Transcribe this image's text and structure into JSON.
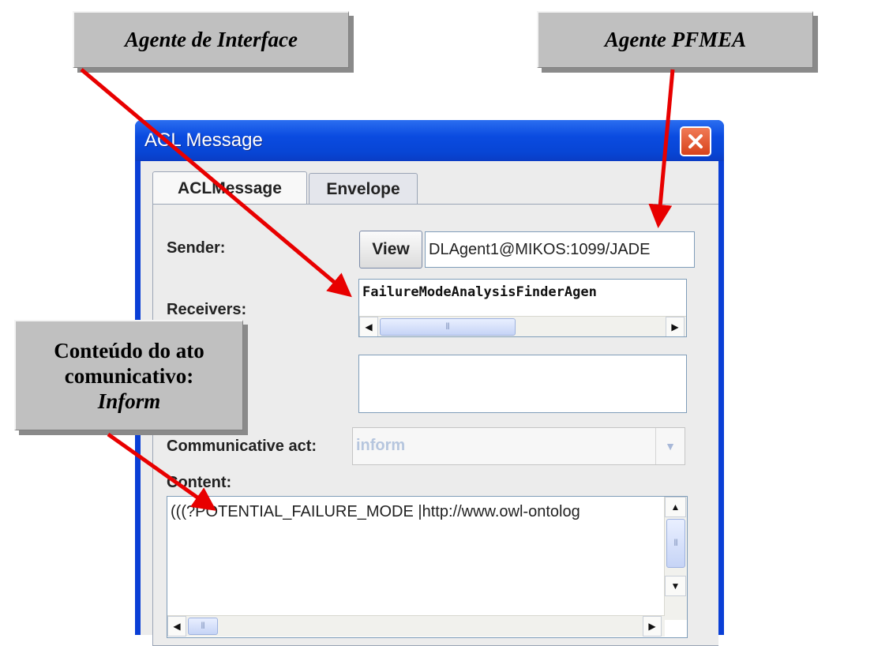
{
  "callouts": {
    "interface_agent": "Agente de Interface",
    "pfmea_agent": "Agente PFMEA",
    "content_line1": "Conteúdo do ato",
    "content_line2": "comunicativo:",
    "content_line3": "Inform"
  },
  "window": {
    "title": "ACL Message",
    "tabs": [
      {
        "label": "ACLMessage",
        "selected": true
      },
      {
        "label": "Envelope",
        "selected": false
      }
    ]
  },
  "form": {
    "sender_label": "Sender:",
    "view_button": "View",
    "sender_value": "DLAgent1@MIKOS:1099/JADE",
    "receivers_label": "Receivers:",
    "receiver_value": "FailureModeAnalysisFinderAgen",
    "communicative_act_label": "Communicative act:",
    "communicative_act_value": "inform",
    "content_label": "Content:",
    "content_value": "(((?POTENTIAL_FAILURE_MODE |http://www.owl-ontolog"
  },
  "icons": {
    "close": "close-icon",
    "arrow_left": "◀",
    "arrow_right": "▶",
    "arrow_up": "▲",
    "arrow_down": "▼",
    "combo_arrow": "▼",
    "grip": "⦀"
  },
  "colors": {
    "titlebar": "#0a4be0",
    "arrow": "#e80000",
    "callout_bg": "#c0c0c0"
  }
}
